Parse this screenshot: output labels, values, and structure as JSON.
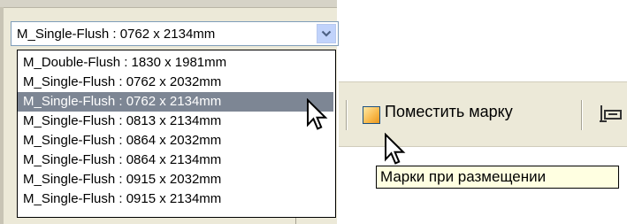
{
  "type_selector": {
    "selected_value": "M_Single-Flush : 0762 x 2134mm",
    "options": [
      "M_Double-Flush : 1830 x 1981mm",
      "M_Single-Flush : 0762 x 2032mm",
      "M_Single-Flush : 0762 x 2134mm",
      "M_Single-Flush : 0813 x 2134mm",
      "M_Single-Flush : 0864 x 2032mm",
      "M_Single-Flush : 0864 x 2134mm",
      "M_Single-Flush : 0915 x 2032mm",
      "M_Single-Flush : 0915 x 2134mm"
    ],
    "highlighted_index": 2
  },
  "toolbar": {
    "tag_on_placement_label": "Поместить марку",
    "tag_on_placement_checked": true
  },
  "tooltip": {
    "text": "Марки при размещении"
  },
  "colors": {
    "selection": "#7d8694",
    "panel": "#ece9d8",
    "tooltip_bg": "#ffffe1",
    "combo_border": "#7f9db9"
  }
}
